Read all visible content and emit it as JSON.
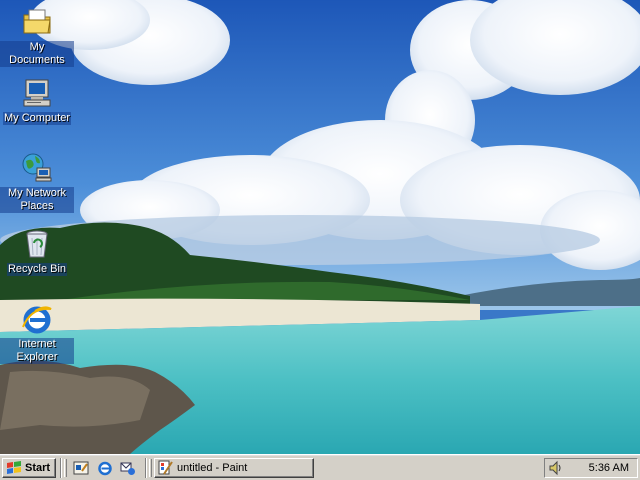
{
  "desktop": {
    "icons": [
      {
        "label": "My Documents",
        "icon": "folder-documents-icon"
      },
      {
        "label": "My Computer",
        "icon": "computer-icon"
      },
      {
        "label": "My Network Places",
        "icon": "network-places-icon"
      },
      {
        "label": "Recycle Bin",
        "icon": "recycle-bin-icon"
      },
      {
        "label": "Internet Explorer",
        "icon": "internet-explorer-icon"
      }
    ]
  },
  "taskbar": {
    "start_label": "Start",
    "quick_launch": [
      {
        "icon": "show-desktop-icon"
      },
      {
        "icon": "internet-explorer-icon"
      },
      {
        "icon": "outlook-express-icon"
      }
    ],
    "tasks": [
      {
        "label": "untitled - Paint",
        "icon": "paint-icon"
      }
    ],
    "tray": {
      "icons": [
        "volume-icon"
      ],
      "clock": "5:36 AM"
    }
  },
  "colors": {
    "taskbar_bg": "#d4d0c8",
    "icon_label_bg": "#1e4a9a",
    "sky": "#2f6fc4",
    "sea": "#4fc3c8"
  }
}
